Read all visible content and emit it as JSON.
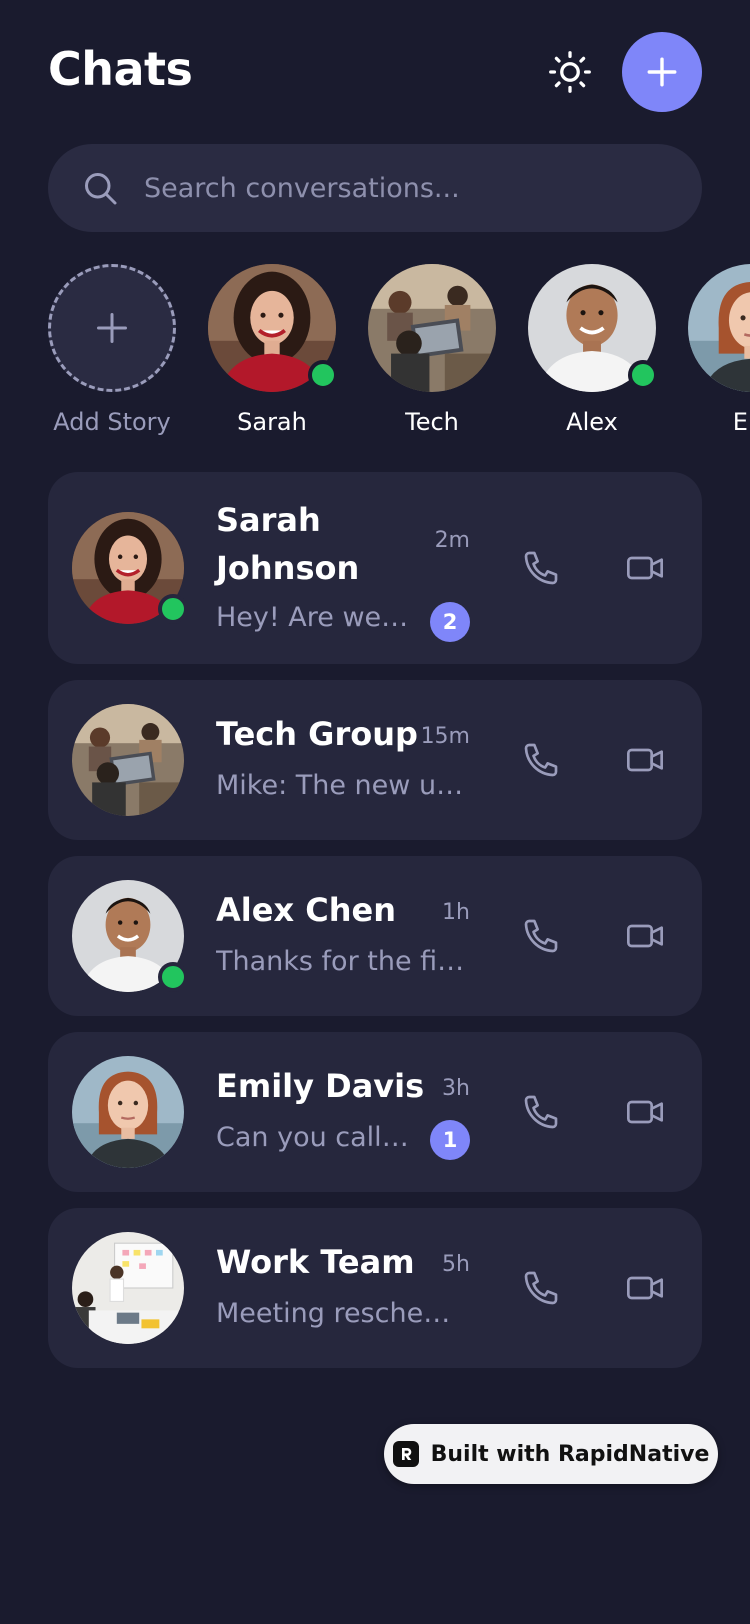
{
  "header": {
    "title": "Chats"
  },
  "search": {
    "placeholder": "Search conversations..."
  },
  "stories": [
    {
      "label": "Add Story",
      "type": "add"
    },
    {
      "label": "Sarah",
      "online": true,
      "avatar": "woman-red-sweater"
    },
    {
      "label": "Tech",
      "online": false,
      "avatar": "group-laptops"
    },
    {
      "label": "Alex",
      "online": true,
      "avatar": "man-white-shirt"
    },
    {
      "label": "Em",
      "online": false,
      "avatar": "woman-redhead"
    }
  ],
  "chats": [
    {
      "name": "Sarah Johnson",
      "time": "2m",
      "preview": "Hey! Are we s...",
      "unread": "2",
      "online": true,
      "avatar": "woman-red-sweater"
    },
    {
      "name": "Tech Group",
      "time": "15m",
      "preview": "Mike: The new up...",
      "unread": null,
      "online": false,
      "avatar": "group-laptops"
    },
    {
      "name": "Alex Chen",
      "time": "1h",
      "preview": "Thanks for the fil...",
      "unread": null,
      "online": true,
      "avatar": "man-white-shirt"
    },
    {
      "name": "Emily Davis",
      "time": "3h",
      "preview": "Can you call ...",
      "unread": "1",
      "online": false,
      "avatar": "woman-redhead"
    },
    {
      "name": "Work Team",
      "time": "5h",
      "preview": "Meeting resched...",
      "unread": null,
      "online": false,
      "avatar": "office-whiteboard"
    }
  ],
  "footer": {
    "built_with": "Built with RapidNative"
  },
  "colors": {
    "background": "#1a1b2e",
    "card": "#26273d",
    "accent": "#7f86f9",
    "online": "#22c55e",
    "muted": "#9a9cbb"
  },
  "icons": [
    "sun-icon",
    "plus-icon",
    "search-icon",
    "phone-icon",
    "video-icon",
    "rapidnative-logo-icon"
  ]
}
